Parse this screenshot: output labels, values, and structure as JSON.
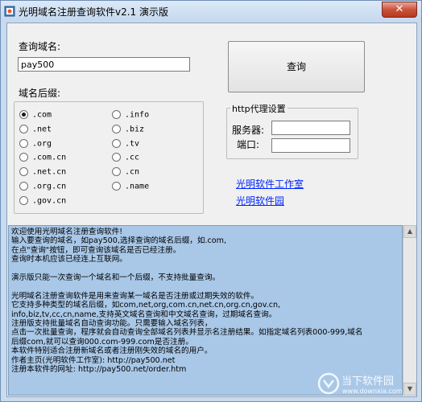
{
  "window": {
    "title": "光明域名注册查询软件v2.1 演示版",
    "close_label": "✕"
  },
  "form": {
    "domain_label": "查询域名:",
    "domain_value": "pay500",
    "query_button": "查询",
    "suffix_label": "域名后缀:"
  },
  "suffixes": {
    "left": [
      {
        "label": ".com",
        "checked": true
      },
      {
        "label": ".net",
        "checked": false
      },
      {
        "label": ".org",
        "checked": false
      },
      {
        "label": ".com.cn",
        "checked": false
      },
      {
        "label": ".net.cn",
        "checked": false
      },
      {
        "label": ".org.cn",
        "checked": false
      },
      {
        "label": ".gov.cn",
        "checked": false
      }
    ],
    "right": [
      {
        "label": ".info",
        "checked": false
      },
      {
        "label": ".biz",
        "checked": false
      },
      {
        "label": ".tv",
        "checked": false
      },
      {
        "label": ".cc",
        "checked": false
      },
      {
        "label": ".cn",
        "checked": false
      },
      {
        "label": ".name",
        "checked": false
      }
    ]
  },
  "proxy": {
    "title": "http代理设置",
    "server_label": "服务器:",
    "port_label": "端口:",
    "server_value": "",
    "port_value": ""
  },
  "links": {
    "studio": "光明软件工作室",
    "garden": "光明软件园"
  },
  "info_lines": [
    "欢迎使用光明域名注册查询软件!",
    "输入要查询的域名，如pay500,选择查询的域名后缀，如.com,",
    "在点\"查询\"按钮，即可查询该域名是否已经注册。",
    "查询时本机应该已经连上互联网。",
    "",
    "演示版只能一次查询一个域名和一个后缀，不支持批量查询。",
    "",
    "光明域名注册查询软件是用来查询某一域名是否注册或过期失效的软件。",
    "它支持多种类型的域名后缀，如com,net,org,com.cn,net.cn,org.cn,gov.cn,",
    "info,biz,tv,cc,cn,name,支持英文域名查询和中文域名查询，过期域名查询。",
    "注册版支持批量域名自动查询功能。只需要输入域名列表，",
    "点击一次批量查询，程序就会自动查询全部域名列表并显示名注册结果。如指定域名列表000-999,域名",
    "后缀com,就可以查询000.com-999.com是否注册。",
    "本软件特别适合注册新域名或者注册刚失效的域名的用户。",
    "作者主页(光明软件工作室): http://pay500.net",
    "注册本软件的网址: http://pay500.net/order.htm"
  ],
  "watermark": {
    "text": "当下软件园",
    "sub": "www.downxia.com"
  }
}
